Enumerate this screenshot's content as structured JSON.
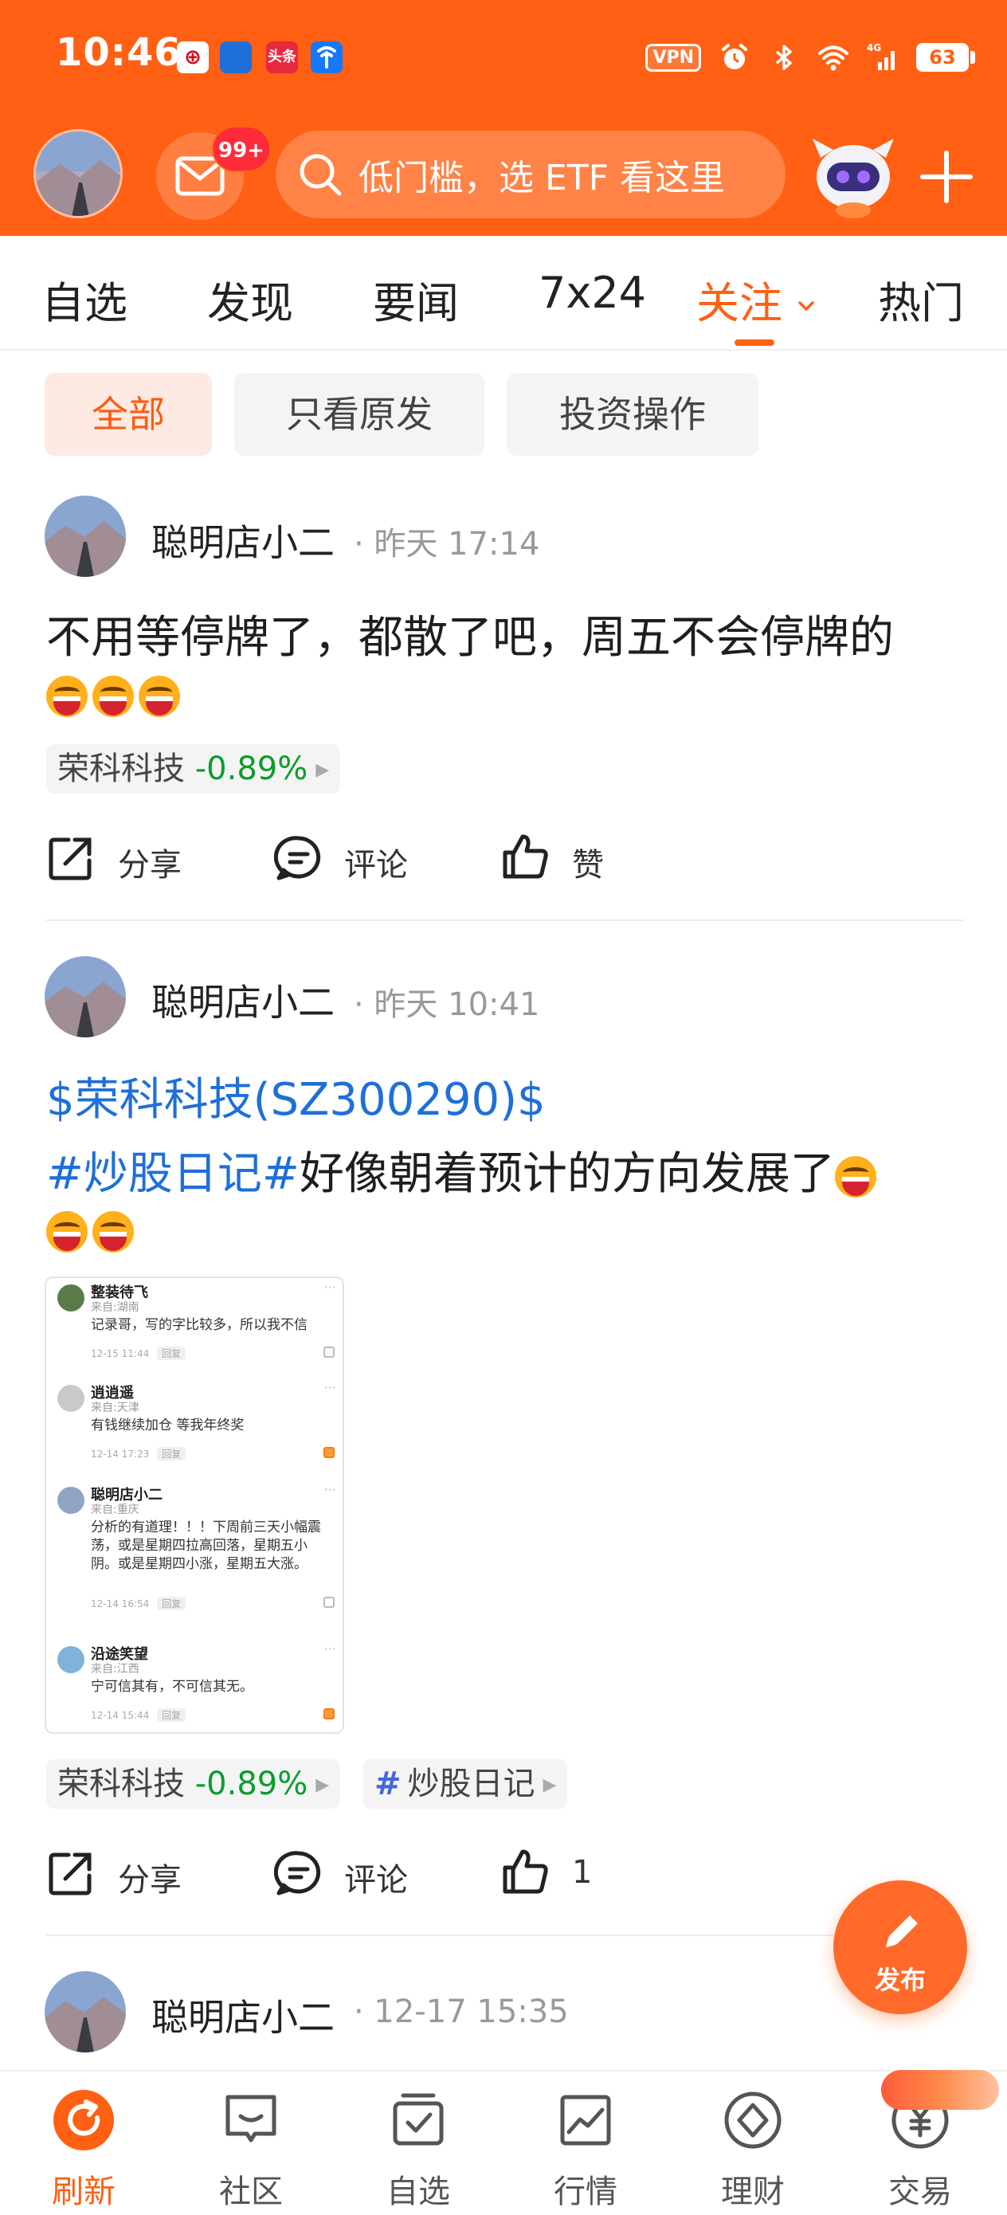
{
  "status_bar": {
    "time": "10:46",
    "notification_icons": [
      "bank-of-china-icon",
      "bank-app-icon",
      "toutiao-news-icon",
      "china-telecom-icon"
    ],
    "news_icon_text": "头条",
    "vpn_label": "VPN",
    "network_label": "4G",
    "battery_level": "63"
  },
  "header": {
    "mail_badge": "99+",
    "search_placeholder": "低门槛，选 ETF 看这里"
  },
  "tabs": [
    {
      "label": "自选"
    },
    {
      "label": "发现"
    },
    {
      "label": "要闻"
    },
    {
      "label": "7x24"
    },
    {
      "label": "关注",
      "active": true
    },
    {
      "label": "热门"
    }
  ],
  "filters": [
    {
      "label": "全部",
      "active": true
    },
    {
      "label": "只看原发"
    },
    {
      "label": "投资操作"
    }
  ],
  "posts": [
    {
      "author": "聪明店小二",
      "time": "· 昨天 17:14",
      "text": "不用等停牌了，都散了吧，周五不会停牌的",
      "stock_tag": {
        "name": "荣科科技",
        "change": "-0.89%"
      },
      "actions": {
        "share": "分享",
        "comment": "评论",
        "like": "赞"
      }
    },
    {
      "author": "聪明店小二",
      "time": "· 昨天 10:41",
      "link_stock": "$荣科科技(SZ300290)$",
      "hashtag": "#炒股日记#",
      "text": "好像朝着预计的方向发展了",
      "screenshot": {
        "comments": [
          {
            "name": "整装待飞",
            "from": "来自:湖南",
            "text": "记录哥，写的字比较多，所以我不信",
            "meta": "12-15 11:44"
          },
          {
            "name": "逍逍遥",
            "from": "来自:天津",
            "text": "有钱继续加仓 等我年终奖",
            "meta": "12-14 17:23"
          },
          {
            "name": "聪明店小二",
            "from": "来自:重庆",
            "text": "分析的有道理！！！下周前三天小幅震荡，或是星期四拉高回落，星期五小阴。或是星期四小涨，星期五大涨。",
            "meta": "12-14 16:54"
          },
          {
            "name": "沿途笑望",
            "from": "来自:江西",
            "text": "宁可信其有，不可信其无。",
            "meta": "12-14 15:44"
          }
        ],
        "reply_label": "回复"
      },
      "stock_tag": {
        "name": "荣科科技",
        "change": "-0.89%"
      },
      "topic_tag": "炒股日记",
      "actions": {
        "share": "分享",
        "comment": "评论",
        "like": "1"
      }
    },
    {
      "author": "聪明店小二",
      "time": "· 12-17 15:35"
    }
  ],
  "fab": {
    "label": "发布"
  },
  "bottom_nav": [
    {
      "label": "刷新",
      "icon": "refresh-icon",
      "active": true
    },
    {
      "label": "社区",
      "icon": "community-icon"
    },
    {
      "label": "自选",
      "icon": "watchlist-icon"
    },
    {
      "label": "行情",
      "icon": "market-chart-icon"
    },
    {
      "label": "理财",
      "icon": "wealth-diamond-icon"
    },
    {
      "label": "交易",
      "icon": "trade-yuan-icon"
    }
  ],
  "colors": {
    "brand": "#ff6014",
    "link": "#1e6fd9",
    "down": "#0a9d2c"
  }
}
